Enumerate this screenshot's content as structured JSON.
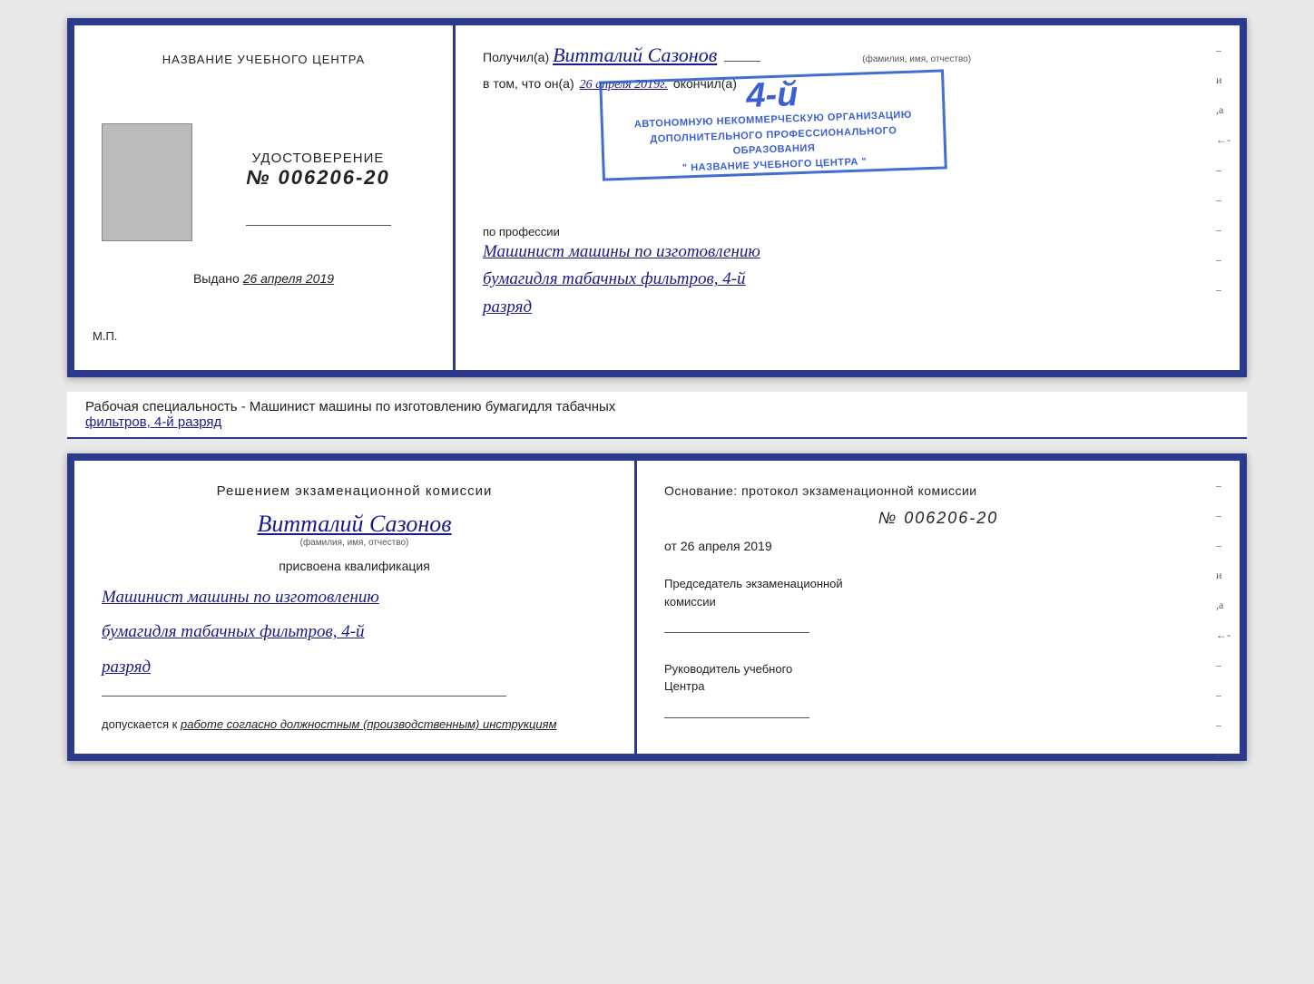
{
  "top_cert": {
    "left": {
      "center_title": "НАЗВАНИЕ УЧЕБНОГО ЦЕНТРА",
      "udostoverenie_label": "УДОСТОВЕРЕНИЕ",
      "number": "№ 006206-20",
      "vydano_label": "Выдано",
      "vydano_date": "26 апреля 2019",
      "mp_label": "М.П."
    },
    "right": {
      "poluchil_label": "Получил(а)",
      "name": "Витталий Сазонов",
      "fio_label": "(фамилия, имя, отчество)",
      "dash": "–",
      "vtom_label": "в том, что он(а)",
      "date": "26 апреля 2019г.",
      "okonchil_label": "окончил(а)",
      "stamp_line1": "АВТОНОМНУЮ НЕКОММЕРЧЕСКУЮ ОРГАНИЗАЦИЮ",
      "stamp_line2": "ДОПОЛНИТЕЛЬНОГО ПРОФЕССИОНАЛЬНОГО ОБРАЗОВАНИЯ",
      "stamp_line3": "\" НАЗВАНИЕ УЧЕБНОГО ЦЕНТРА \"",
      "stamp_number": "4-й",
      "po_professii": "по профессии",
      "profession_line1": "Машинист машины по изготовлению",
      "profession_line2": "бумагидля табачных фильтров, 4-й",
      "profession_line3": "разряд"
    }
  },
  "middle": {
    "text": "Рабочая специальность - Машинист машины по изготовлению бумагидля табачных",
    "underline_text": "фильтров, 4-й разряд"
  },
  "bottom_cert": {
    "left": {
      "komissia_title": "Решением экзаменационной комиссии",
      "name": "Витталий Сазонов",
      "fio_label": "(фамилия, имя, отчество)",
      "prisvoyena": "присвоена квалификация",
      "qual_line1": "Машинист машины по изготовлению",
      "qual_line2": "бумагидля табачных фильтров, 4-й",
      "qual_line3": "разряд",
      "dopuskaetsya_label": "допускается к",
      "dopuskaetsya_text": "работе согласно должностным (производственным) инструкциям"
    },
    "right": {
      "osnovaniye": "Основание: протокол экзаменационной комиссии",
      "number": "№  006206-20",
      "ot_label": "от",
      "ot_date": "26 апреля 2019",
      "predsedatel_line1": "Председатель экзаменационной",
      "predsedatel_line2": "комиссии",
      "rukovoditel_line1": "Руководитель учебного",
      "rukovoditel_line2": "Центра"
    }
  }
}
